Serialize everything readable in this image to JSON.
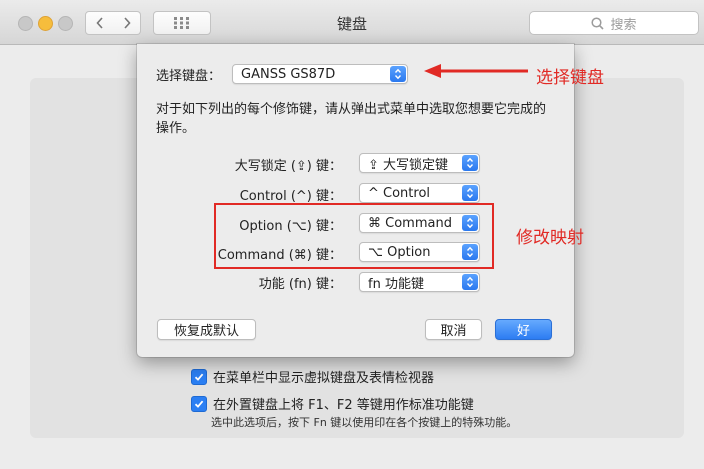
{
  "window": {
    "title": "键盘",
    "search_placeholder": "搜索"
  },
  "sheet": {
    "keyboard_select_label": "选择键盘：",
    "keyboard_select_value": "GANSS  GS87D",
    "instruction": "对于如下列出的每个修饰键，请从弹出式菜单中选取您想要它完成的操作。",
    "rows": [
      {
        "label": "大写锁定 (⇪) 键：",
        "value": "⇪ 大写锁定键"
      },
      {
        "label": "Control (^) 键：",
        "value": "^ Control"
      },
      {
        "label": "Option (⌥) 键：",
        "value": "⌘ Command"
      },
      {
        "label": "Command (⌘) 键：",
        "value": "⌥ Option"
      },
      {
        "label": "功能 (fn) 键：",
        "value": "fn 功能键"
      }
    ],
    "restore_defaults_button": "恢复成默认",
    "cancel_button": "取消",
    "ok_button": "好"
  },
  "background": {
    "checkbox1_label": "在菜单栏中显示虚拟键盘及表情检视器",
    "checkbox2_label": "在外置键盘上将 F1、F2 等键用作标准功能键",
    "checkbox2_note": "选中此选项后，按下 Fn 键以使用印在各个按键上的特殊功能。"
  },
  "annotations": {
    "select_keyboard": "选择键盘",
    "modifier_mapping": "修改映射",
    "color": "#e12a25"
  },
  "colors": {
    "accent": "#2b7ff3"
  }
}
